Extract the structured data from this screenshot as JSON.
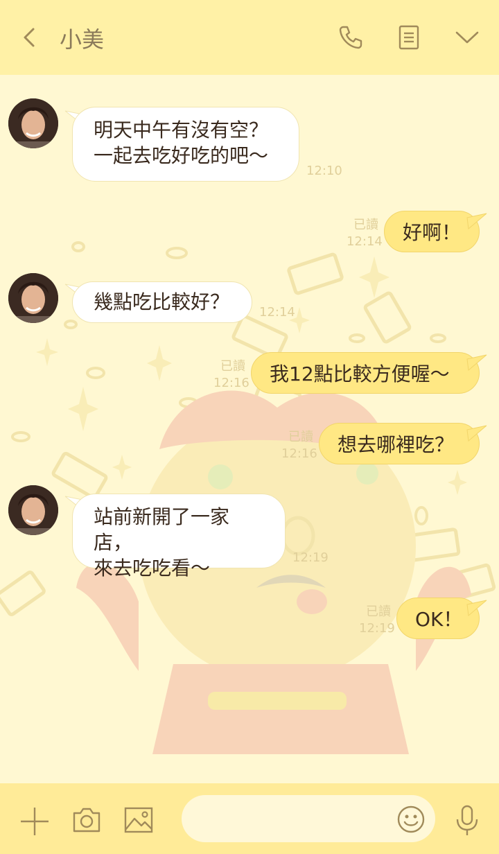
{
  "header": {
    "contact_name": "小美",
    "back_icon": "chevron-left-icon",
    "call_icon": "phone-icon",
    "notes_icon": "note-icon",
    "menu_icon": "chevron-down-icon"
  },
  "messages": [
    {
      "dir": "in",
      "text": "明天中午有沒有空？\n一起去吃好吃的吧～",
      "time": "12:10"
    },
    {
      "dir": "out",
      "text": "好啊！",
      "read": "已讀",
      "time": "12:14"
    },
    {
      "dir": "in",
      "text": "幾點吃比較好？",
      "time": "12:14"
    },
    {
      "dir": "out",
      "text": "我12點比較方便喔～",
      "read": "已讀",
      "time": "12:16"
    },
    {
      "dir": "out",
      "text": "想去哪裡吃？",
      "read": "已讀",
      "time": "12:16"
    },
    {
      "dir": "in",
      "text": "站前新開了一家店，\n來去吃吃看～",
      "time": "12:19"
    },
    {
      "dir": "out",
      "text": "OK！",
      "read": "已讀",
      "time": "12:19"
    }
  ],
  "footer": {
    "plus_icon": "plus-icon",
    "camera_icon": "camera-icon",
    "image_icon": "image-icon",
    "emoji_icon": "emoji-icon",
    "mic_icon": "microphone-icon"
  },
  "colors": {
    "header_bg": "#FFF1A6",
    "chat_bg": "#FFF8D2",
    "outgoing_bubble": "#FFE884",
    "incoming_bubble": "#FFFFFF",
    "icon": "#A08A5A"
  }
}
